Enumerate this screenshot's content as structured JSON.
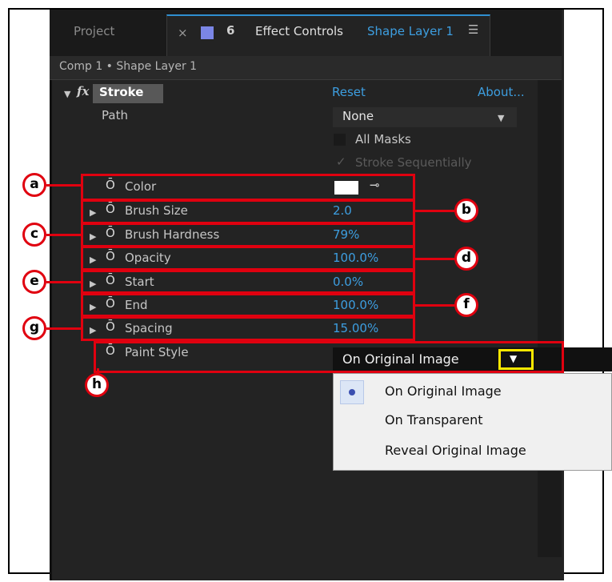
{
  "tabs": {
    "project": "Project",
    "close_glyph": "×",
    "lock_glyph": "6",
    "effect_controls": "Effect Controls",
    "layer_name": "Shape Layer 1",
    "menu_glyph": "☰"
  },
  "breadcrumb": "Comp 1 • Shape Layer 1",
  "effect": {
    "fx_label": "fx",
    "name": "Stroke",
    "reset": "Reset",
    "about": "About..."
  },
  "path": {
    "label": "Path",
    "value": "None"
  },
  "all_masks": "All Masks",
  "stroke_sequentially": "Stroke Sequentially",
  "properties": [
    {
      "label": "Color",
      "value": "",
      "color": "#ffffff"
    },
    {
      "label": "Brush Size",
      "value": "2.0"
    },
    {
      "label": "Brush Hardness",
      "value": "79%"
    },
    {
      "label": "Opacity",
      "value": "100.0%"
    },
    {
      "label": "Start",
      "value": "0.0%"
    },
    {
      "label": "End",
      "value": "100.0%"
    },
    {
      "label": "Spacing",
      "value": "15.00%"
    }
  ],
  "paint_style": {
    "label": "Paint Style",
    "value": "On Original Image"
  },
  "paint_style_options": [
    "On Original Image",
    "On Transparent",
    "Reveal Original Image"
  ],
  "callouts": [
    "a",
    "b",
    "c",
    "d",
    "e",
    "f",
    "g",
    "h"
  ],
  "colors": {
    "accent_blue": "#3d9ee0",
    "callout_red": "#e0000f",
    "highlight_yellow": "#ffe800"
  }
}
